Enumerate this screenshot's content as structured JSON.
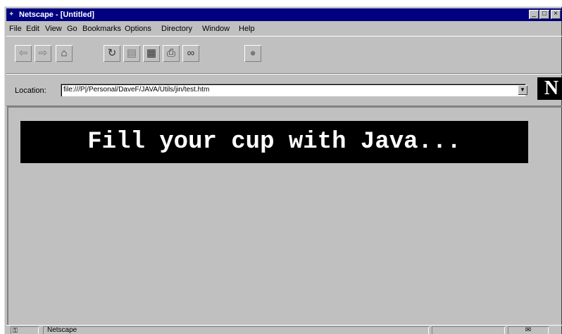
{
  "window": {
    "title": "Netscape - [Untitled]"
  },
  "title_buttons": {
    "minimize": "_",
    "maximize": "□",
    "close": "×"
  },
  "menu": [
    "File",
    "Edit",
    "View",
    "Go",
    "Bookmarks",
    "Options",
    "Directory",
    "Window",
    "Help"
  ],
  "toolbar": {
    "back_icon": "back-arrow-icon",
    "forward_icon": "forward-arrow-icon",
    "home_icon": "home-icon",
    "reload_icon": "reload-icon",
    "images_icon": "images-icon",
    "open_icon": "open-icon",
    "print_icon": "print-icon",
    "find_icon": "find-binoculars-icon",
    "stop_icon": "stop-icon"
  },
  "location": {
    "label": "Location:",
    "url": "file:///P|/Personal/DaveF/JAVA/Utils/jin/test.htm"
  },
  "logo": {
    "letter": "N"
  },
  "content": {
    "banner_text": "Fill your cup with Java..."
  },
  "status": {
    "text": "Netscape"
  },
  "colors": {
    "titlebar": "#000080",
    "chrome": "#c0c0c0",
    "banner_bg": "#000000",
    "banner_text": "#ffffff"
  }
}
